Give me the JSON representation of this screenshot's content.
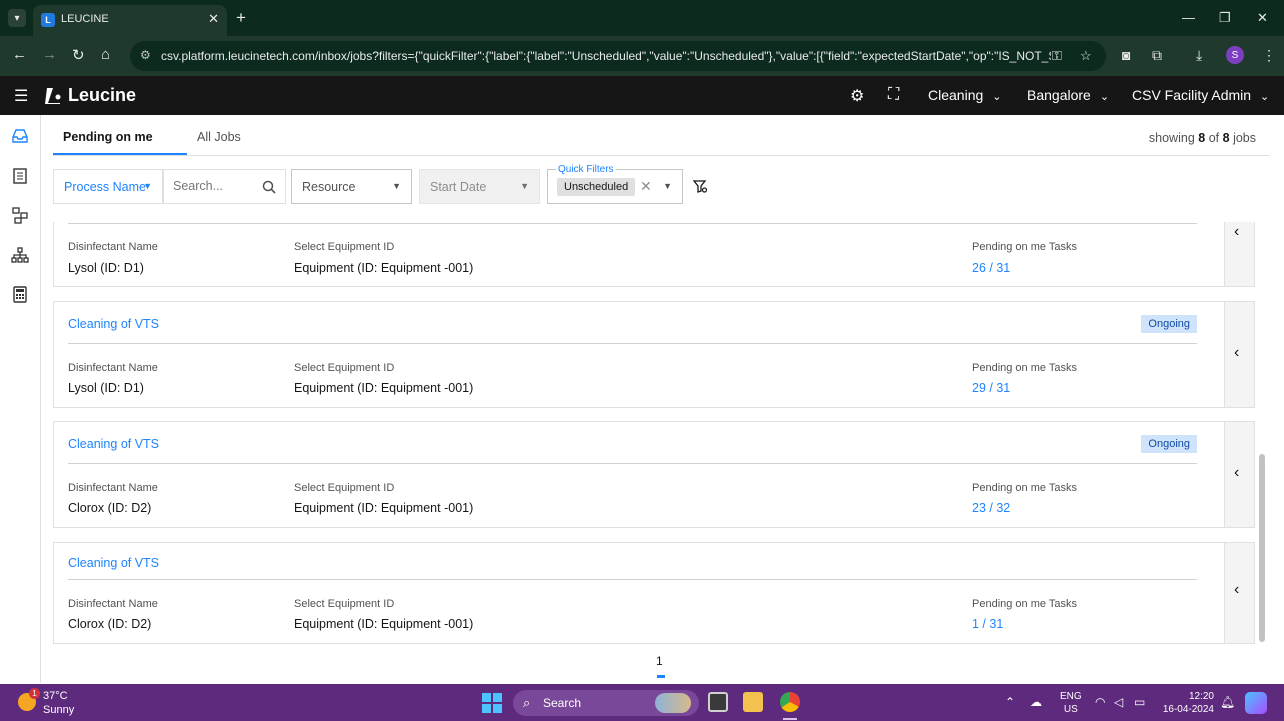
{
  "browser": {
    "tab_title": "LEUCINE",
    "url": "csv.platform.leucinetech.com/inbox/jobs?filters={\"quickFilter\":{\"label\":{\"label\":\"Unscheduled\",\"value\":\"Unscheduled\"},\"value\":[{\"field\":\"expectedStartDate\",\"op\":\"IS_NOT_SET...",
    "profile_initial": "S"
  },
  "app": {
    "brand": "Leucine",
    "header": {
      "module_label": "Cleaning",
      "facility_label": "Bangalore",
      "role_label": "CSV Facility Admin"
    }
  },
  "tabs": [
    {
      "label": "Pending on me"
    },
    {
      "label": "All Jobs"
    }
  ],
  "showing": {
    "prefix": "showing",
    "count": "8",
    "middle": "of",
    "total": "8",
    "suffix": "jobs"
  },
  "filters": {
    "process_name_label": "Process Name",
    "search_placeholder": "Search...",
    "resource_label": "Resource",
    "start_date_label": "Start Date",
    "quick_filters_legend": "Quick Filters",
    "quick_filter_chip": "Unscheduled"
  },
  "jobs": [
    {
      "title": "",
      "status": "",
      "field1_label": "Disinfectant Name",
      "field1_value": "Lysol (ID: D1)",
      "field2_label": "Select Equipment ID",
      "field2_value": "Equipment (ID: Equipment -001)",
      "tasks_label": "Pending on me Tasks",
      "tasks_value": "26 / 31"
    },
    {
      "title": "Cleaning of VTS",
      "status": "Ongoing",
      "field1_label": "Disinfectant Name",
      "field1_value": "Lysol (ID: D1)",
      "field2_label": "Select Equipment ID",
      "field2_value": "Equipment (ID: Equipment -001)",
      "tasks_label": "Pending on me Tasks",
      "tasks_value": "29 / 31"
    },
    {
      "title": "Cleaning of VTS",
      "status": "Ongoing",
      "field1_label": "Disinfectant Name",
      "field1_value": "Clorox (ID: D2)",
      "field2_label": "Select Equipment ID",
      "field2_value": "Equipment (ID: Equipment -001)",
      "tasks_label": "Pending on me Tasks",
      "tasks_value": "23 / 32"
    },
    {
      "title": "Cleaning of VTS",
      "status": "",
      "field1_label": "Disinfectant Name",
      "field1_value": "Clorox (ID: D2)",
      "field2_label": "Select Equipment ID",
      "field2_value": "Equipment (ID: Equipment -001)",
      "tasks_label": "Pending on me Tasks",
      "tasks_value": "1 / 31"
    }
  ],
  "pagination": {
    "current": "1"
  },
  "taskbar": {
    "weather_badge": "1",
    "weather_temp": "37°C",
    "weather_desc": "Sunny",
    "search_label": "Search",
    "lang_top": "ENG",
    "lang_bottom": "US",
    "time": "12:20",
    "date": "16-04-2024"
  },
  "icons": {
    "rail": [
      "inbox-icon",
      "clipboard-icon",
      "process-flow-icon",
      "hierarchy-icon",
      "calculator-icon"
    ],
    "header": [
      "gear-icon",
      "scan-icon"
    ]
  },
  "colors": {
    "accent": "#1d84ff",
    "app_header": "#161616",
    "browser_frame": "#1f3a2d",
    "taskbar": "#5e2a7d",
    "badge_bg": "#cfe3fb"
  }
}
